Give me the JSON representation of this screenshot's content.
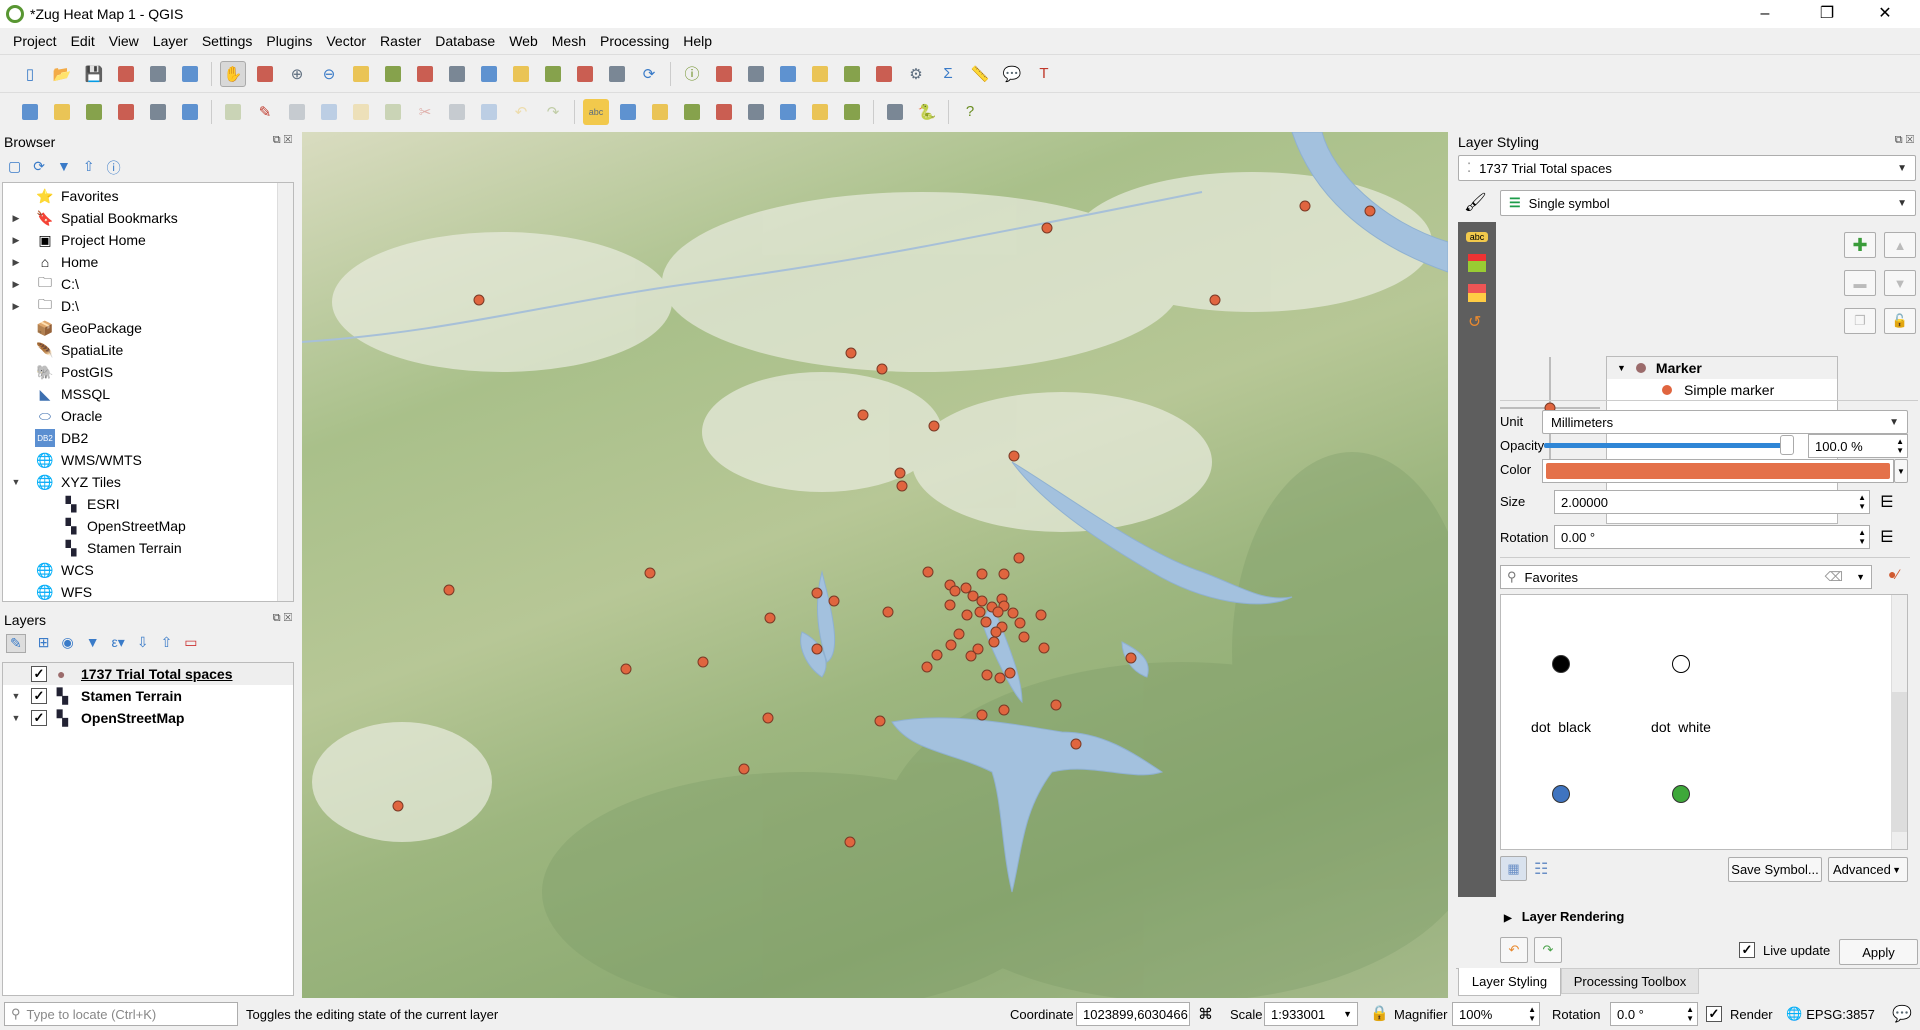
{
  "window": {
    "title": "*Zug Heat Map 1 - QGIS",
    "minimize": "–",
    "restore": "❐",
    "close": "✕"
  },
  "menu": [
    "Project",
    "Edit",
    "View",
    "Layer",
    "Settings",
    "Plugins",
    "Vector",
    "Raster",
    "Database",
    "Web",
    "Mesh",
    "Processing",
    "Help"
  ],
  "toolbar1": [
    "new-project",
    "open-project",
    "save-project",
    "save-as",
    "print-layout",
    "style-manager",
    "|",
    "pan",
    "pan-to-selection",
    "zoom-in",
    "zoom-out",
    "zoom-full",
    "zoom-to-selection",
    "zoom-to-layer",
    "zoom-native",
    "zoom-last",
    "zoom-next",
    "new-bookmark",
    "new-spatial-bookmark",
    "show-bookmarks",
    "refresh",
    "|",
    "identify",
    "action",
    "select-features",
    "select-by-value",
    "deselect",
    "attribute-table",
    "field-calculator",
    "toolbox",
    "statistics",
    "measure",
    "map-tips",
    "text-annotation"
  ],
  "toolbar2": [
    "data-source-manager",
    "new-geopackage",
    "new-shapefile",
    "new-spatialite",
    "new-virtual-layer",
    "new-temp-layer",
    "|",
    "current-edits",
    "toggle-editing",
    "save-edits",
    "add-feature",
    "vertex-tool",
    "delete-selected",
    "cut",
    "copy",
    "paste",
    "undo",
    "redo",
    "|",
    "label-tool",
    "diagram",
    "pin-labels",
    "highlight-pinned",
    "show-hide-labels",
    "move-label",
    "rotate-label",
    "change-label",
    "label-properties",
    "|",
    "quickmapservices",
    "python-console",
    "|",
    "help"
  ],
  "browser": {
    "title": "Browser",
    "items": [
      {
        "label": "Favorites",
        "icon": "star-icon",
        "arrow": ""
      },
      {
        "label": "Spatial Bookmarks",
        "icon": "bookmark-icon",
        "arrow": "▶"
      },
      {
        "label": "Project Home",
        "icon": "project-home-icon",
        "arrow": "▶"
      },
      {
        "label": "Home",
        "icon": "home-icon",
        "arrow": "▶"
      },
      {
        "label": "C:\\",
        "icon": "folder-icon",
        "arrow": "▶"
      },
      {
        "label": "D:\\",
        "icon": "folder-icon",
        "arrow": "▶"
      },
      {
        "label": "GeoPackage",
        "icon": "geopackage-icon",
        "arrow": ""
      },
      {
        "label": "SpatiaLite",
        "icon": "spatialite-icon",
        "arrow": ""
      },
      {
        "label": "PostGIS",
        "icon": "postgis-icon",
        "arrow": ""
      },
      {
        "label": "MSSQL",
        "icon": "mssql-icon",
        "arrow": ""
      },
      {
        "label": "Oracle",
        "icon": "oracle-icon",
        "arrow": ""
      },
      {
        "label": "DB2",
        "icon": "db2-icon",
        "arrow": ""
      },
      {
        "label": "WMS/WMTS",
        "icon": "globe-icon",
        "arrow": ""
      },
      {
        "label": "XYZ Tiles",
        "icon": "globe-icon",
        "arrow": "▼"
      },
      {
        "label": "ESRI",
        "icon": "tiles-icon",
        "arrow": "",
        "child": true
      },
      {
        "label": "OpenStreetMap",
        "icon": "tiles-icon",
        "arrow": "",
        "child": true
      },
      {
        "label": "Stamen Terrain",
        "icon": "tiles-icon",
        "arrow": "",
        "child": true
      },
      {
        "label": "WCS",
        "icon": "globe-icon",
        "arrow": ""
      },
      {
        "label": "WFS",
        "icon": "globe-icon",
        "arrow": ""
      }
    ]
  },
  "layers": {
    "title": "Layers",
    "items": [
      {
        "label": "1737 Trial Total spaces",
        "checked": true,
        "icon": "point-layer-icon",
        "arrow": "",
        "selected": true
      },
      {
        "label": "Stamen Terrain",
        "checked": true,
        "icon": "tiles-icon",
        "arrow": "▼"
      },
      {
        "label": "OpenStreetMap",
        "checked": true,
        "icon": "tiles-icon",
        "arrow": "▼"
      }
    ]
  },
  "styling": {
    "title": "Layer Styling",
    "layer": "1737 Trial Total spaces",
    "renderer": "Single symbol",
    "tree": {
      "root": "Marker",
      "child": "Simple marker"
    },
    "unit_label": "Unit",
    "unit": "Millimeters",
    "opacity_label": "Opacity",
    "opacity": "100.0 %",
    "opacity_value": 100,
    "color_label": "Color",
    "color": "#e4714a",
    "size_label": "Size",
    "size": "2.00000",
    "rotation_label": "Rotation",
    "rotation": "0.00 °",
    "search": "Favorites",
    "symbols": [
      {
        "label": "dot  black",
        "fill": "#000000"
      },
      {
        "label": "dot  white",
        "fill": "#ffffff"
      },
      {
        "label": "",
        "fill": "#3f74c0"
      },
      {
        "label": "",
        "fill": "#3ea83a"
      }
    ],
    "save_symbol": "Save Symbol...",
    "advanced": "Advanced",
    "layer_rendering": "Layer Rendering",
    "live_update": "Live update",
    "live_update_checked": true,
    "apply": "Apply",
    "tabs": [
      "Layer Styling",
      "Processing Toolbox"
    ]
  },
  "marker_color": "#e0653f",
  "status": {
    "locate_placeholder": "Type to locate (Ctrl+K)",
    "message": "Toggles the editing state of the current layer",
    "coordinate_label": "Coordinate",
    "coordinate": "1023899,6030466",
    "scale_label": "Scale",
    "scale": "1:933001",
    "magnifier_label": "Magnifier",
    "magnifier": "100%",
    "rotation_label": "Rotation",
    "rotation": "0.0 °",
    "render_label": "Render",
    "render_checked": true,
    "crs": "EPSG:3857"
  }
}
